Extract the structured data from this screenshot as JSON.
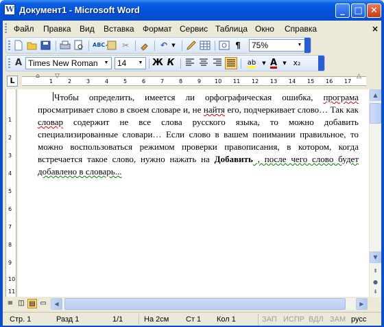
{
  "window": {
    "title": "Документ1 - Microsoft Word",
    "app_icon_letter": "W",
    "minimize_glyph": "_",
    "maximize_glyph": "□",
    "close_glyph": "✕"
  },
  "menu": {
    "items": [
      "Файл",
      "Правка",
      "Вид",
      "Вставка",
      "Формат",
      "Сервис",
      "Таблица",
      "Окно",
      "Справка"
    ],
    "close_glyph": "×"
  },
  "standard_toolbar": {
    "zoom": "75%",
    "icons": [
      "new-document-icon",
      "open-folder-icon",
      "save-icon",
      "print-icon",
      "print-preview-icon",
      "spelling-icon",
      "research-icon",
      "cut-icon",
      "format-painter-icon",
      "undo-icon",
      "insert-table-icon",
      "columns-icon",
      "drawing-icon",
      "show-formatting-icon"
    ]
  },
  "formatting_toolbar": {
    "style_glyph": "A",
    "font_name": "Times New Roman",
    "font_size": "14",
    "bold": "Ж",
    "italic": "К",
    "highlight_glyph": "ab",
    "font_color_glyph": "A",
    "subscript_glyph": "x₂"
  },
  "ruler": {
    "corner_glyph": "L",
    "h_numbers": [
      "1",
      "2",
      "3",
      "4",
      "5",
      "6",
      "7",
      "8",
      "9",
      "10",
      "11",
      "12",
      "13",
      "14",
      "15",
      "16",
      "17"
    ],
    "v_numbers": [
      "1",
      "2",
      "3",
      "4",
      "5",
      "6",
      "7",
      "8",
      "9",
      "10",
      "11"
    ]
  },
  "document": {
    "p1_a": "Чтобы определить, имеется ли орфографическая ошибка, ",
    "p1_err1": "програма",
    "p1_b": " просматривает слово в своем словаре и, не ",
    "p1_err2": "найтя",
    "p1_c": " его, подчеркивает слово… Так как ",
    "p1_err3": "словар",
    "p1_d": " содержит не все слова русского языка, то можно добавить специализированные словари… Если слово в вашем понимании правильное, то можно воспользоваться режимом проверки правописания, в котором, когда встречается такое слово, нужно нажать на ",
    "p1_bold": "Добавить",
    "p1_e": " , после чего слово будет добавлено в словарь..."
  },
  "status": {
    "page": "Стр. 1",
    "section": "Разд 1",
    "pages": "1/1",
    "at": "На 2см",
    "line": "Ст 1",
    "col": "Кол 1",
    "rec": "ЗАП",
    "trk": "ИСПР",
    "ext": "ВДЛ",
    "ovr": "ЗАМ",
    "lang": "русс"
  },
  "colors": {
    "titlebar": "#0050d8",
    "spell_error": "#d00000",
    "grammar_error": "#008000"
  }
}
